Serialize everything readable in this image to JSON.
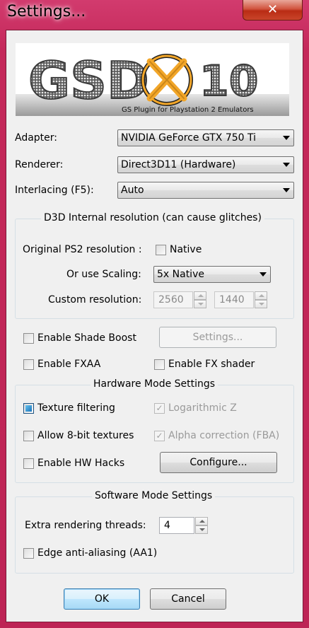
{
  "window": {
    "title": "Settings...",
    "close_glyph": "✕"
  },
  "logo": {
    "main_text": "GSD",
    "version": "10",
    "subtitle": "GS Plugin  for Playstation 2 Emulators"
  },
  "adapter": {
    "label": "Adapter:",
    "value": "NVIDIA GeForce GTX 750 Ti"
  },
  "renderer": {
    "label": "Renderer:",
    "value": "Direct3D11 (Hardware)"
  },
  "interlacing": {
    "label": "Interlacing (F5):",
    "value": "Auto"
  },
  "resolution_group": {
    "title": "D3D Internal resolution (can cause glitches)",
    "original_label": "Original PS2 resolution :",
    "native_label": "Native",
    "native_checked": false,
    "scaling_label": "Or use Scaling:",
    "scaling_value": "5x Native",
    "custom_label": "Custom resolution:",
    "custom_width": "2560",
    "custom_height": "1440"
  },
  "shade_boost": {
    "label": "Enable Shade Boost",
    "checked": false,
    "settings_button": "Settings..."
  },
  "fxaa": {
    "label": "Enable FXAA",
    "checked": false
  },
  "fx_shader": {
    "label": "Enable FX shader",
    "checked": false
  },
  "hardware_group": {
    "title": "Hardware Mode Settings",
    "texture_filtering": {
      "label": "Texture filtering",
      "state": "indeterminate"
    },
    "logarithmic_z": {
      "label": "Logarithmic Z",
      "checked": true,
      "disabled": true
    },
    "allow_8bit": {
      "label": "Allow 8-bit textures",
      "checked": false
    },
    "alpha_correction": {
      "label": "Alpha correction (FBA)",
      "checked": true,
      "disabled": true
    },
    "hw_hacks": {
      "label": "Enable HW Hacks",
      "checked": false
    },
    "configure_button": "Configure..."
  },
  "software_group": {
    "title": "Software Mode Settings",
    "threads_label": "Extra rendering threads:",
    "threads_value": "4",
    "edge_aa_label": "Edge anti-aliasing (AA1)",
    "edge_aa_checked": false
  },
  "buttons": {
    "ok": "OK",
    "cancel": "Cancel"
  },
  "check_glyph": "✓",
  "colors": {
    "frame": "#c4285a",
    "client_bg": "#f0f0f0",
    "logo_accent": "#f2a629"
  }
}
